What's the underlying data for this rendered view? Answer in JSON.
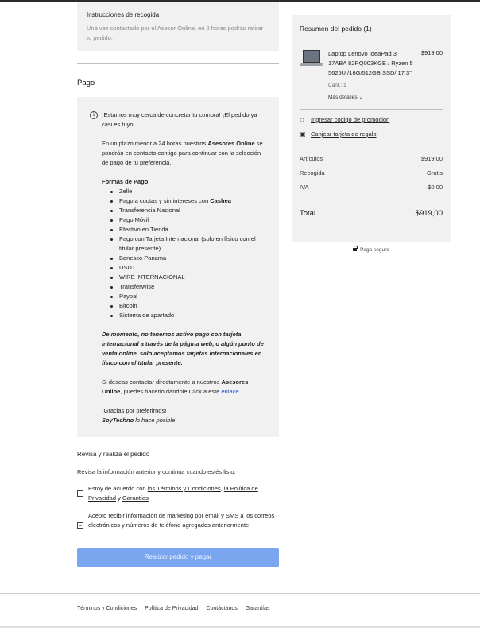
{
  "pickup": {
    "title": "Instrucciones de recogida",
    "text": "Una vez contactado por el Asesor Online, en 2 horas podrás retirar tu pedido."
  },
  "payment": {
    "title": "Pago",
    "intro": "¡Estamos muy cerca de concretar tu compra! ¡El pedido ya casi es tuyo!",
    "p1_pre": "En un plazo menor a 24 horas nuestros ",
    "p1_bold": "Asesores Online",
    "p1_post": " se pondrán en contacto contigo para continuar con la selección de pago de tu preferencia.",
    "methods_title": "Formas de Pago",
    "methods": [
      "Zelle",
      "Pago a cuotas y sin intereses con Cashea",
      "Transferencia Nacional",
      "Pago Móvil",
      "Efectivo en Tienda",
      "Pago con Tarjeta Internacional (solo en físico con el titular presente)",
      "Banesco Panama",
      "USDT",
      "WIRE INTERNACIONAL",
      "TransferWise",
      "Paypal",
      "Bitcoin",
      "Sistema de apartado"
    ],
    "notice": "De momento, no tenemos activo pago con tarjeta internacional a través de la página web, o algún punto de venta online, solo aceptamos tarjetas internacionales en físico con el titular presente.",
    "contact_pre": "Si deseas contactar directamente a nuestros ",
    "contact_bold": "Asesores Online",
    "contact_mid": ", puedes hacerlo dandole Click a este ",
    "contact_link": "enlace",
    "contact_end": ".",
    "thanks": "¡Gracias por preferirnos!",
    "brand": "SoyTechno",
    "brand_tail": " lo hace posible"
  },
  "review": {
    "title": "Revisa y realiza el pedido",
    "subtitle": "Revisa la información anterior y continúa cuando estés listo.",
    "terms_pre": "Estoy de acuerdo con ",
    "terms_link1": "los Términos y Condiciones",
    "terms_sep": ", ",
    "terms_link2": "la Política de Privacidad",
    "terms_and": " y ",
    "terms_link3": "Garantías",
    "marketing": "Acepto recibir información de marketing por email y SMS a los correos electrónicos y números de teléfono agregados anteriormente",
    "submit_label": "Realizar pedido y pagar"
  },
  "summary": {
    "title": "Resumen del pedido (1)",
    "product_name": "Laptop Lenovo IdeaPad 3 17ABA 82RQ003KGE / Ryzen 5 5625U /16G/512GB SSD/ 17.3\"",
    "product_price": "$919,00",
    "quantity": "Cant.: 1",
    "more_details": "Más detalles",
    "promo": "Ingresar código de promoción",
    "gift": "Canjear tarjeta de regalo",
    "lines": [
      {
        "label": "Artículos",
        "value": "$919,00"
      },
      {
        "label": "Recogida",
        "value": "Gratis"
      },
      {
        "label": "IVA",
        "value": "$0,00"
      }
    ],
    "total_label": "Total",
    "total_value": "$919,00",
    "secure": "Pago seguro"
  },
  "footer": {
    "links": [
      "Términos y Condiciones",
      "Política de Privacidad",
      "Contáctanos",
      "Garantías"
    ]
  }
}
